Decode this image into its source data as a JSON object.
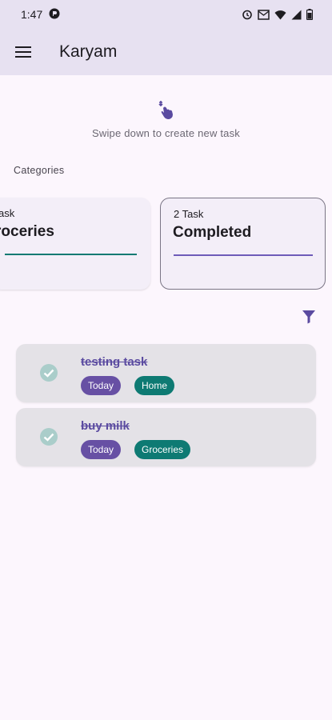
{
  "status": {
    "time": "1:47"
  },
  "appbar": {
    "title": "Karyam"
  },
  "hint": {
    "text": "Swipe down to create new task"
  },
  "categories": {
    "label": "Categories",
    "items": [
      {
        "count": "ask",
        "name": "roceries"
      },
      {
        "count": "2 Task",
        "name": "Completed",
        "selected": true
      }
    ]
  },
  "tasks": [
    {
      "title": "testing task",
      "date": "Today",
      "category": "Home",
      "completed": true
    },
    {
      "title": "buy milk",
      "date": "Today",
      "category": "Groceries",
      "completed": true
    }
  ],
  "colors": {
    "primary": "#6750a4",
    "teal": "#0e7a73",
    "header": "#e7e1f1",
    "background": "#fcf6fd"
  },
  "icons": [
    "menu-icon",
    "swipe-down-icon",
    "filter-icon",
    "check-circle-icon",
    "alarm-icon",
    "wifi-icon",
    "signal-icon",
    "battery-icon"
  ]
}
